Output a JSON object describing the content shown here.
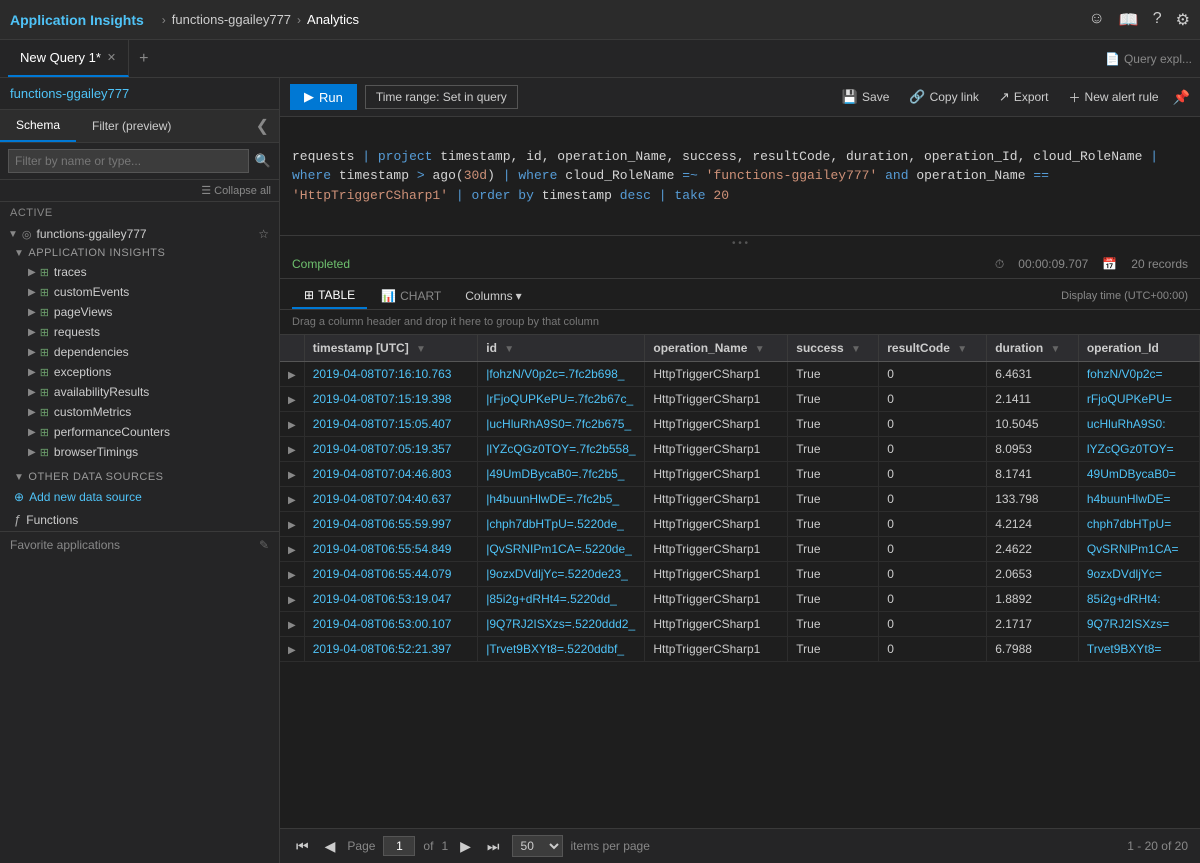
{
  "topNav": {
    "appTitle": "Application Insights",
    "breadcrumb": [
      {
        "label": "functions-ggailey777",
        "active": false
      },
      {
        "label": "Analytics",
        "active": true
      }
    ],
    "icons": [
      "smiley",
      "book",
      "question",
      "gear"
    ]
  },
  "tabs": [
    {
      "label": "New Query 1*",
      "active": true
    }
  ],
  "addTabLabel": "+",
  "queryExplLabel": "Query expl...",
  "resourceLink": "functions-ggailey777",
  "schema": {
    "tabs": [
      {
        "label": "Schema",
        "active": true
      },
      {
        "label": "Filter (preview)",
        "active": false
      }
    ],
    "collapseIcon": "❮",
    "filterPlaceholder": "Filter by name or type...",
    "collapseAllLabel": "Collapse all",
    "active": {
      "sectionLabel": "Active",
      "resource": {
        "name": "functions-ggailey777",
        "starIcon": "☆"
      },
      "appInsightsLabel": "APPLICATION INSIGHTS",
      "tables": [
        {
          "name": "traces"
        },
        {
          "name": "customEvents"
        },
        {
          "name": "pageViews"
        },
        {
          "name": "requests"
        },
        {
          "name": "dependencies"
        },
        {
          "name": "exceptions"
        },
        {
          "name": "availabilityResults"
        },
        {
          "name": "customMetrics"
        },
        {
          "name": "performanceCounters"
        },
        {
          "name": "browserTimings"
        }
      ]
    },
    "otherDataSources": {
      "label": "OTHER DATA SOURCES",
      "addLabel": "Add new data source",
      "functionsLabel": "Functions"
    },
    "favoriteLabel": "Favorite applications"
  },
  "toolbar": {
    "runLabel": "Run",
    "timeRangeLabel": "Time range: Set in query",
    "saveLabel": "Save",
    "copyLinkLabel": "Copy link",
    "exportLabel": "Export",
    "newAlertLabel": "New alert rule"
  },
  "query": {
    "text": "requests | project timestamp, id, operation_Name, success, resultCode, duration, operation_Id, cloud_RoleName |\nwhere timestamp > ago(30d) | where cloud_RoleName =~ 'functions-ggailey777' and operation_Name ==\n'HttpTriggerCSharp1' | order by timestamp desc | take 20"
  },
  "results": {
    "status": "Completed",
    "duration": "00:00:09.707",
    "recordCount": "20 records",
    "dragHint": "Drag a column header and drop it here to group by that column",
    "displayTime": "Display time (UTC+00:00)",
    "tabs": [
      {
        "label": "TABLE",
        "active": true
      },
      {
        "label": "CHART",
        "active": false
      }
    ],
    "columnsLabel": "Columns",
    "columns": [
      "timestamp [UTC]",
      "id",
      "operation_Name",
      "success",
      "resultCode",
      "duration",
      "operation_Id"
    ],
    "rows": [
      {
        "timestamp": "2019-04-08T07:16:10.763",
        "id": "|fohzN/V0p2c=.7fc2b698_",
        "operation_Name": "HttpTriggerCSharp1",
        "success": "True",
        "resultCode": "0",
        "duration": "6.4631",
        "operation_Id": "fohzN/V0p2c="
      },
      {
        "timestamp": "2019-04-08T07:15:19.398",
        "id": "|rFjoQUPKePU=.7fc2b67c_",
        "operation_Name": "HttpTriggerCSharp1",
        "success": "True",
        "resultCode": "0",
        "duration": "2.1411",
        "operation_Id": "rFjoQUPKePU="
      },
      {
        "timestamp": "2019-04-08T07:15:05.407",
        "id": "|ucHluRhA9S0=.7fc2b675_",
        "operation_Name": "HttpTriggerCSharp1",
        "success": "True",
        "resultCode": "0",
        "duration": "10.5045",
        "operation_Id": "ucHluRhA9S0:"
      },
      {
        "timestamp": "2019-04-08T07:05:19.357",
        "id": "|lYZcQGz0TOY=.7fc2b558_",
        "operation_Name": "HttpTriggerCSharp1",
        "success": "True",
        "resultCode": "0",
        "duration": "8.0953",
        "operation_Id": "lYZcQGz0TOY="
      },
      {
        "timestamp": "2019-04-08T07:04:46.803",
        "id": "|49UmDBycaB0=.7fc2b5_",
        "operation_Name": "HttpTriggerCSharp1",
        "success": "True",
        "resultCode": "0",
        "duration": "8.1741",
        "operation_Id": "49UmDBycaB0="
      },
      {
        "timestamp": "2019-04-08T07:04:40.637",
        "id": "|h4buunHlwDE=.7fc2b5_",
        "operation_Name": "HttpTriggerCSharp1",
        "success": "True",
        "resultCode": "0",
        "duration": "133.798",
        "operation_Id": "h4buunHlwDE="
      },
      {
        "timestamp": "2019-04-08T06:55:59.997",
        "id": "|chph7dbHTpU=.5220de_",
        "operation_Name": "HttpTriggerCSharp1",
        "success": "True",
        "resultCode": "0",
        "duration": "4.2124",
        "operation_Id": "chph7dbHTpU="
      },
      {
        "timestamp": "2019-04-08T06:55:54.849",
        "id": "|QvSRNIPm1CA=.5220de_",
        "operation_Name": "HttpTriggerCSharp1",
        "success": "True",
        "resultCode": "0",
        "duration": "2.4622",
        "operation_Id": "QvSRNlPm1CA="
      },
      {
        "timestamp": "2019-04-08T06:55:44.079",
        "id": "|9ozxDVdljYc=.5220de23_",
        "operation_Name": "HttpTriggerCSharp1",
        "success": "True",
        "resultCode": "0",
        "duration": "2.0653",
        "operation_Id": "9ozxDVdljYc="
      },
      {
        "timestamp": "2019-04-08T06:53:19.047",
        "id": "|85i2g+dRHt4=.5220dd_",
        "operation_Name": "HttpTriggerCSharp1",
        "success": "True",
        "resultCode": "0",
        "duration": "1.8892",
        "operation_Id": "85i2g+dRHt4:"
      },
      {
        "timestamp": "2019-04-08T06:53:00.107",
        "id": "|9Q7RJ2ISXzs=.5220ddd2_",
        "operation_Name": "HttpTriggerCSharp1",
        "success": "True",
        "resultCode": "0",
        "duration": "2.1717",
        "operation_Id": "9Q7RJ2ISXzs="
      },
      {
        "timestamp": "2019-04-08T06:52:21.397",
        "id": "|Trvet9BXYt8=.5220ddbf_",
        "operation_Name": "HttpTriggerCSharp1",
        "success": "True",
        "resultCode": "0",
        "duration": "6.7988",
        "operation_Id": "Trvet9BXYt8="
      }
    ],
    "footer": {
      "pageLabel": "Page",
      "currentPage": "1",
      "totalPages": "1",
      "itemsPerPage": "50",
      "rangeLabel": "1 - 20 of 20"
    }
  }
}
